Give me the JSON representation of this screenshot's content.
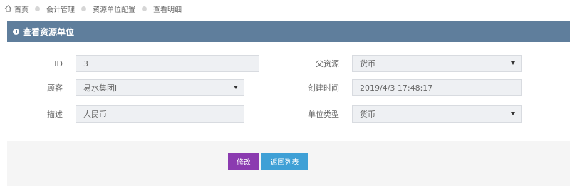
{
  "breadcrumb": {
    "home": "首页",
    "items": [
      "会计管理",
      "资源单位配置",
      "查看明细"
    ]
  },
  "panel": {
    "title": "查看资源单位"
  },
  "form": {
    "id": {
      "label": "ID",
      "value": "3"
    },
    "parent_resource": {
      "label": "父资源",
      "value": "货币"
    },
    "customer": {
      "label": "顾客",
      "value": "易水集团i"
    },
    "created_time": {
      "label": "创建时间",
      "value": "2019/4/3 17:48:17"
    },
    "description": {
      "label": "描述",
      "value": "人民币"
    },
    "unit_type": {
      "label": "单位类型",
      "value": "货币"
    }
  },
  "buttons": {
    "edit": "修改",
    "back": "返回列表"
  },
  "colors": {
    "header": "#5f7e9c",
    "edit_button": "#8b3bb0",
    "back_button": "#3fa0d6"
  }
}
